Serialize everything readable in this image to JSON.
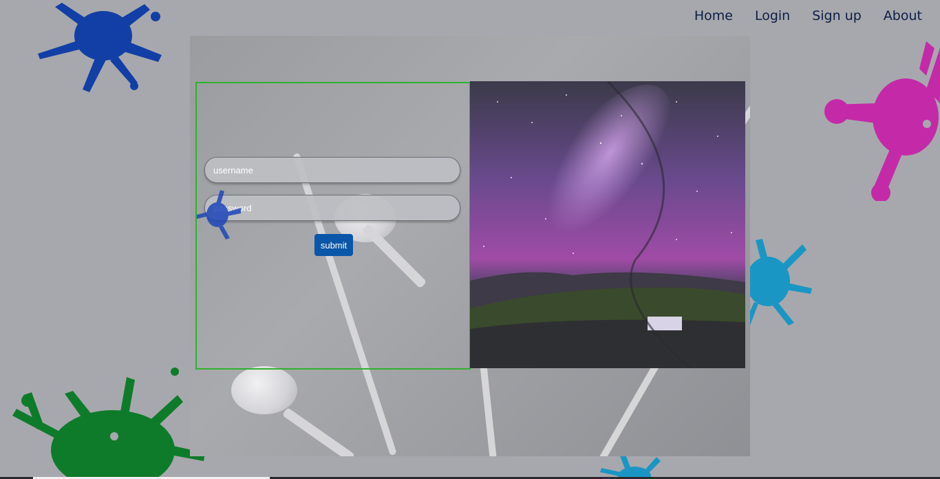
{
  "nav": {
    "items": [
      {
        "label": "Home"
      },
      {
        "label": "Login"
      },
      {
        "label": "Sign up"
      },
      {
        "label": "About"
      }
    ]
  },
  "login_form": {
    "username": {
      "placeholder": "username",
      "value": ""
    },
    "password": {
      "placeholder": "password",
      "value": ""
    },
    "submit_label": "submit"
  },
  "colors": {
    "nav_text": "#0c1e45",
    "form_border": "#2fb12f",
    "submit_bg": "#0a56a8",
    "splat_blue": "#123fa6",
    "splat_magenta": "#c42aa8",
    "splat_cyan": "#1a96c4",
    "splat_green": "#0e7b2a"
  }
}
